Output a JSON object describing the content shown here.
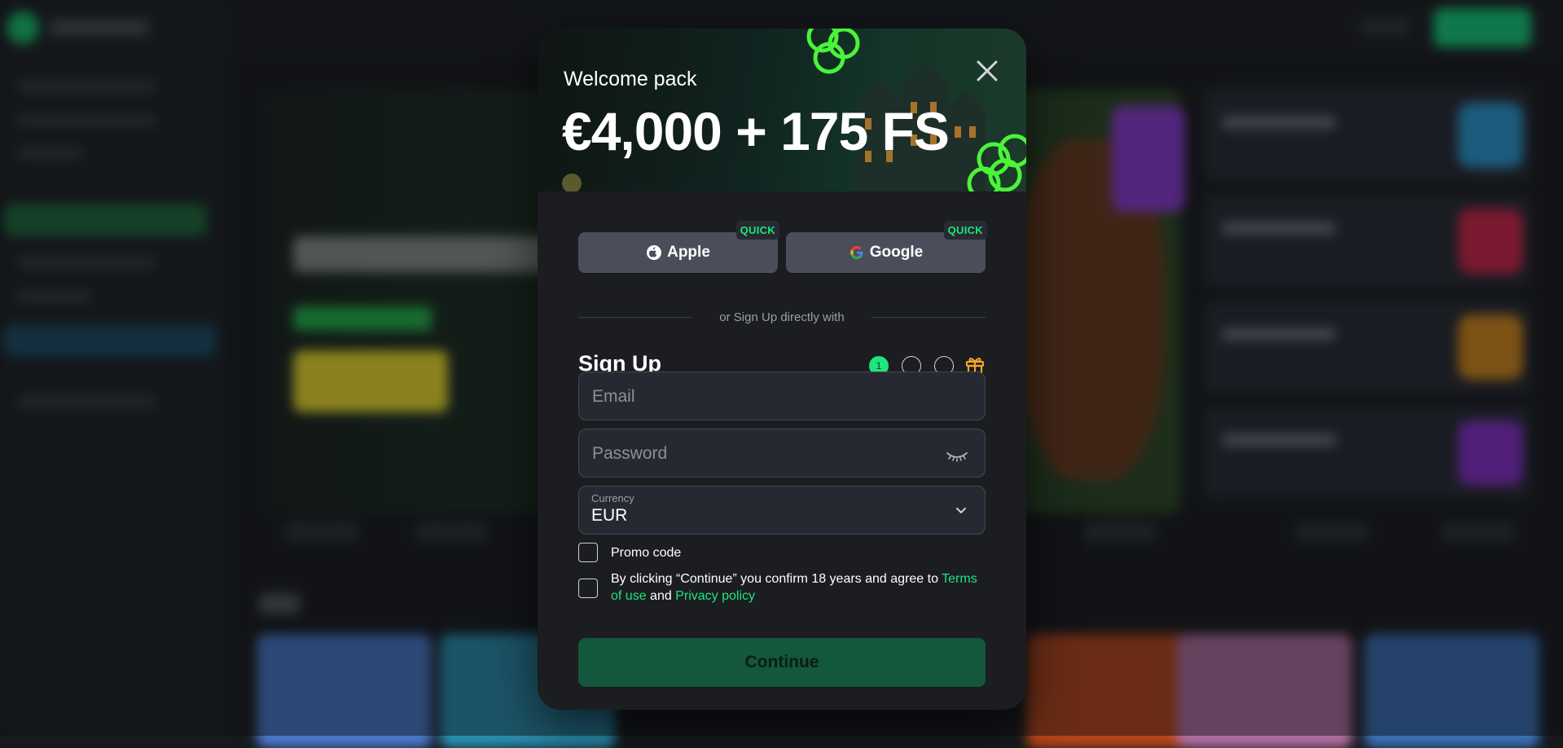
{
  "banner": {
    "title": "Welcome pack",
    "amount": "€4,000 + 175 FS"
  },
  "quick_login": {
    "apple_label": "Apple",
    "google_label": "Google",
    "badge": "QUICK"
  },
  "divider_text": "or Sign Up directly with",
  "signup": {
    "title": "Sign Up",
    "current_step": "1"
  },
  "form": {
    "email_placeholder": "Email",
    "password_placeholder": "Password",
    "currency_label": "Currency",
    "currency_value": "EUR",
    "promo_label": "Promo code",
    "terms_prefix": "By clicking “Continue” you confirm 18 years and agree to ",
    "terms_link": "Terms of use",
    "terms_and": " and ",
    "privacy_link": "Privacy policy",
    "continue_label": "Continue"
  },
  "colors": {
    "accent": "#1ee57f",
    "continue_bg": "#13573c",
    "social_bg": "#4b4e5a",
    "modal_bg": "#1b1d21",
    "gift": "#f5a623"
  },
  "icons": [
    "close-icon",
    "apple-icon",
    "google-icon",
    "eye-closed-icon",
    "chevron-down-icon",
    "gift-icon"
  ]
}
